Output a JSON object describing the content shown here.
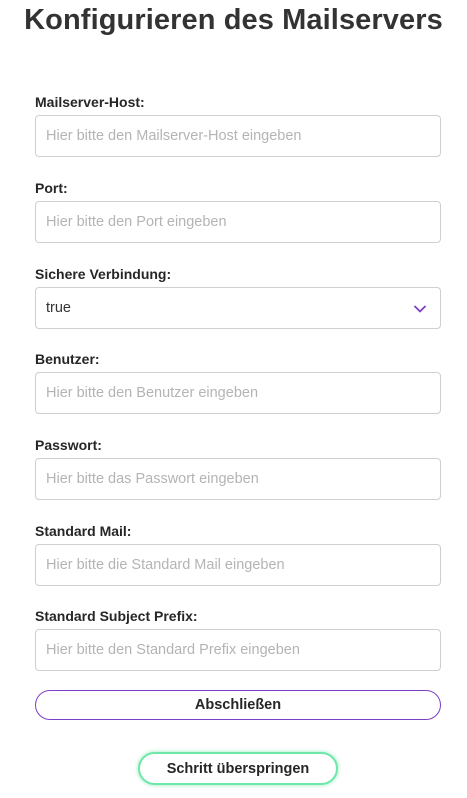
{
  "page": {
    "title": "Konfigurieren des Mailservers"
  },
  "form": {
    "host": {
      "label": "Mailserver-Host:",
      "placeholder": "Hier bitte den Mailserver-Host eingeben",
      "value": ""
    },
    "port": {
      "label": "Port:",
      "placeholder": "Hier bitte den Port eingeben",
      "value": ""
    },
    "secure": {
      "label": "Sichere Verbindung:",
      "value": "true"
    },
    "user": {
      "label": "Benutzer:",
      "placeholder": "Hier bitte den Benutzer eingeben",
      "value": ""
    },
    "password": {
      "label": "Passwort:",
      "placeholder": "Hier bitte das Passwort eingeben",
      "value": ""
    },
    "default_mail": {
      "label": "Standard Mail:",
      "placeholder": "Hier bitte die Standard Mail eingeben",
      "value": ""
    },
    "subject_prefix": {
      "label": "Standard Subject Prefix:",
      "placeholder": "Hier bitte den Standard Prefix eingeben",
      "value": ""
    }
  },
  "actions": {
    "finish_label": "Abschließen",
    "skip_label": "Schritt überspringen"
  },
  "icons": {
    "select_chevron": "chevron-down-icon"
  },
  "colors": {
    "accent_purple": "#7d3fc8",
    "accent_green": "#6ee7a8",
    "text": "#333333",
    "placeholder": "#b4b4b4",
    "border": "#cfcfcf"
  }
}
